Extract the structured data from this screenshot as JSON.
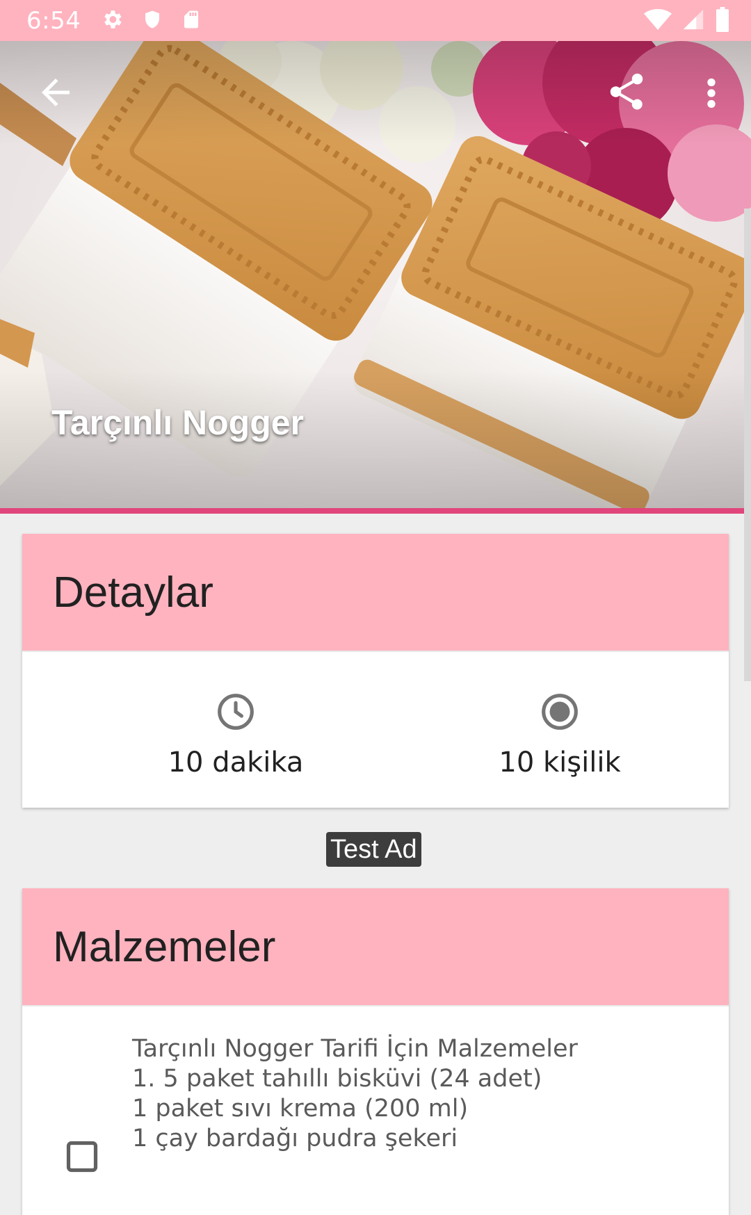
{
  "status_bar": {
    "time": "6:54",
    "left_icons": [
      "settings-icon",
      "shield-icon",
      "sd-card-icon"
    ],
    "right_icons": [
      "wifi-icon",
      "signal-icon",
      "battery-icon"
    ]
  },
  "toolbar": {
    "back_icon": "arrow-back-icon",
    "share_icon": "share-icon",
    "more_icon": "more-vert-icon"
  },
  "recipe": {
    "title": "Tarçınlı Nogger"
  },
  "details": {
    "header": "Detaylar",
    "time_value": "10 dakika",
    "time_icon": "clock-icon",
    "servings_value": "10 kişilik",
    "servings_icon": "radio-circle-icon"
  },
  "ad": {
    "label": "Test Ad"
  },
  "ingredients": {
    "header": "Malzemeler",
    "text": "Tarçınlı Nogger Tarifi İçin Malzemeler\n1. 5 paket tahıllı bisküvi (24 adet)\n1 paket sıvı krema (200 ml)\n1 çay bardağı pudra şekeri"
  },
  "colors": {
    "accent_pink": "#ffb3bf",
    "rule_pink": "#e0457b",
    "background": "#eeeeee"
  }
}
